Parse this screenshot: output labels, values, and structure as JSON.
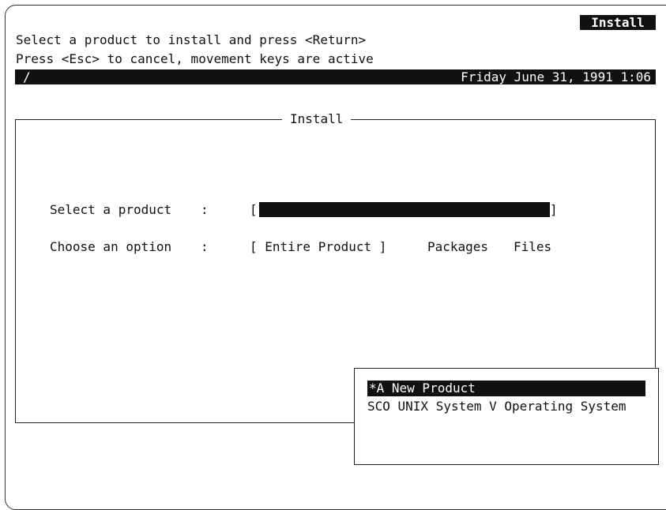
{
  "header": {
    "badge": "Install",
    "instruction_line1": "Select a product to install and press <Return>",
    "instruction_line2": "Press <Esc> to cancel, movement keys are active"
  },
  "status_bar": {
    "path": "/",
    "datetime": "Friday June 31, 1991 1:06"
  },
  "form": {
    "title": "Install",
    "fields": {
      "product": {
        "label": "Select a product",
        "colon": ":",
        "open_bracket": "[",
        "close_bracket": "]",
        "value": ""
      },
      "option": {
        "label": "Choose an option",
        "colon": ":",
        "choices": [
          "[ Entire Product ]",
          "Packages",
          "Files"
        ],
        "selected": "Entire Product"
      }
    }
  },
  "product_list": {
    "items": [
      "*A New Product",
      "SCO UNIX System V Operating System"
    ],
    "selected_index": 0
  },
  "colors": {
    "highlight_bg": "#111111",
    "highlight_fg": "#ffffff",
    "background": "#ffffff"
  }
}
